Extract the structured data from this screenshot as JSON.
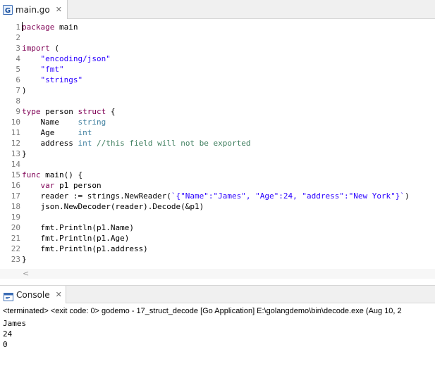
{
  "editor_tab": {
    "label": "main.go",
    "close": "✕",
    "icon": "go-file-icon"
  },
  "lines": [
    {
      "num": "1",
      "parts": [
        {
          "c": "kw",
          "t": "package"
        },
        {
          "c": "",
          "t": " main"
        }
      ]
    },
    {
      "num": "2",
      "parts": []
    },
    {
      "num": "3",
      "parts": [
        {
          "c": "kw",
          "t": "import"
        },
        {
          "c": "",
          "t": " ("
        }
      ]
    },
    {
      "num": "4",
      "parts": [
        {
          "c": "",
          "t": "    "
        },
        {
          "c": "st",
          "t": "\"encoding/json\""
        }
      ]
    },
    {
      "num": "5",
      "parts": [
        {
          "c": "",
          "t": "    "
        },
        {
          "c": "st",
          "t": "\"fmt\""
        }
      ]
    },
    {
      "num": "6",
      "parts": [
        {
          "c": "",
          "t": "    "
        },
        {
          "c": "st",
          "t": "\"strings\""
        }
      ]
    },
    {
      "num": "7",
      "parts": [
        {
          "c": "",
          "t": ")"
        }
      ]
    },
    {
      "num": "8",
      "parts": []
    },
    {
      "num": "9",
      "parts": [
        {
          "c": "kw",
          "t": "type"
        },
        {
          "c": "",
          "t": " person "
        },
        {
          "c": "kw",
          "t": "struct"
        },
        {
          "c": "",
          "t": " {"
        }
      ]
    },
    {
      "num": "10",
      "parts": [
        {
          "c": "",
          "t": "    Name    "
        },
        {
          "c": "ty",
          "t": "string"
        }
      ]
    },
    {
      "num": "11",
      "parts": [
        {
          "c": "",
          "t": "    Age     "
        },
        {
          "c": "ty",
          "t": "int"
        }
      ]
    },
    {
      "num": "12",
      "parts": [
        {
          "c": "",
          "t": "    address "
        },
        {
          "c": "ty",
          "t": "int"
        },
        {
          "c": "",
          "t": " "
        },
        {
          "c": "cm",
          "t": "//this field will not be exported"
        }
      ]
    },
    {
      "num": "13",
      "parts": [
        {
          "c": "",
          "t": "}"
        }
      ]
    },
    {
      "num": "14",
      "parts": []
    },
    {
      "num": "15",
      "parts": [
        {
          "c": "kw",
          "t": "func"
        },
        {
          "c": "",
          "t": " main() {"
        }
      ]
    },
    {
      "num": "16",
      "parts": [
        {
          "c": "",
          "t": "    "
        },
        {
          "c": "kw",
          "t": "var"
        },
        {
          "c": "",
          "t": " p1 person"
        }
      ]
    },
    {
      "num": "17",
      "parts": [
        {
          "c": "",
          "t": "    reader := strings.NewReader("
        },
        {
          "c": "st",
          "t": "`{\"Name\":\"James\", \"Age\":24, \"address\":\"New York\"}`"
        },
        {
          "c": "",
          "t": ")"
        }
      ]
    },
    {
      "num": "18",
      "parts": [
        {
          "c": "",
          "t": "    json.NewDecoder(reader).Decode(&p1)"
        }
      ]
    },
    {
      "num": "19",
      "parts": []
    },
    {
      "num": "20",
      "parts": [
        {
          "c": "",
          "t": "    fmt.Println(p1.Name)"
        }
      ]
    },
    {
      "num": "21",
      "parts": [
        {
          "c": "",
          "t": "    fmt.Println(p1.Age)"
        }
      ]
    },
    {
      "num": "22",
      "parts": [
        {
          "c": "",
          "t": "    fmt.Println(p1.address)"
        }
      ]
    },
    {
      "num": "23",
      "parts": [
        {
          "c": "",
          "t": "}"
        }
      ]
    }
  ],
  "scroll_arrow": "<",
  "console_tab": {
    "label": "Console",
    "close": "✕",
    "icon": "console-icon"
  },
  "console_status": "<terminated> <exit code: 0> godemo - 17_struct_decode [Go Application] E:\\golangdemo\\bin\\decode.exe (Aug 10, 2",
  "console_output": [
    "James",
    "24",
    "0"
  ],
  "colors": {
    "keyword": "#7f0055",
    "type": "#3f7f9f",
    "string": "#2a00ff",
    "comment": "#3f7f5f",
    "line_number": "#787878"
  }
}
